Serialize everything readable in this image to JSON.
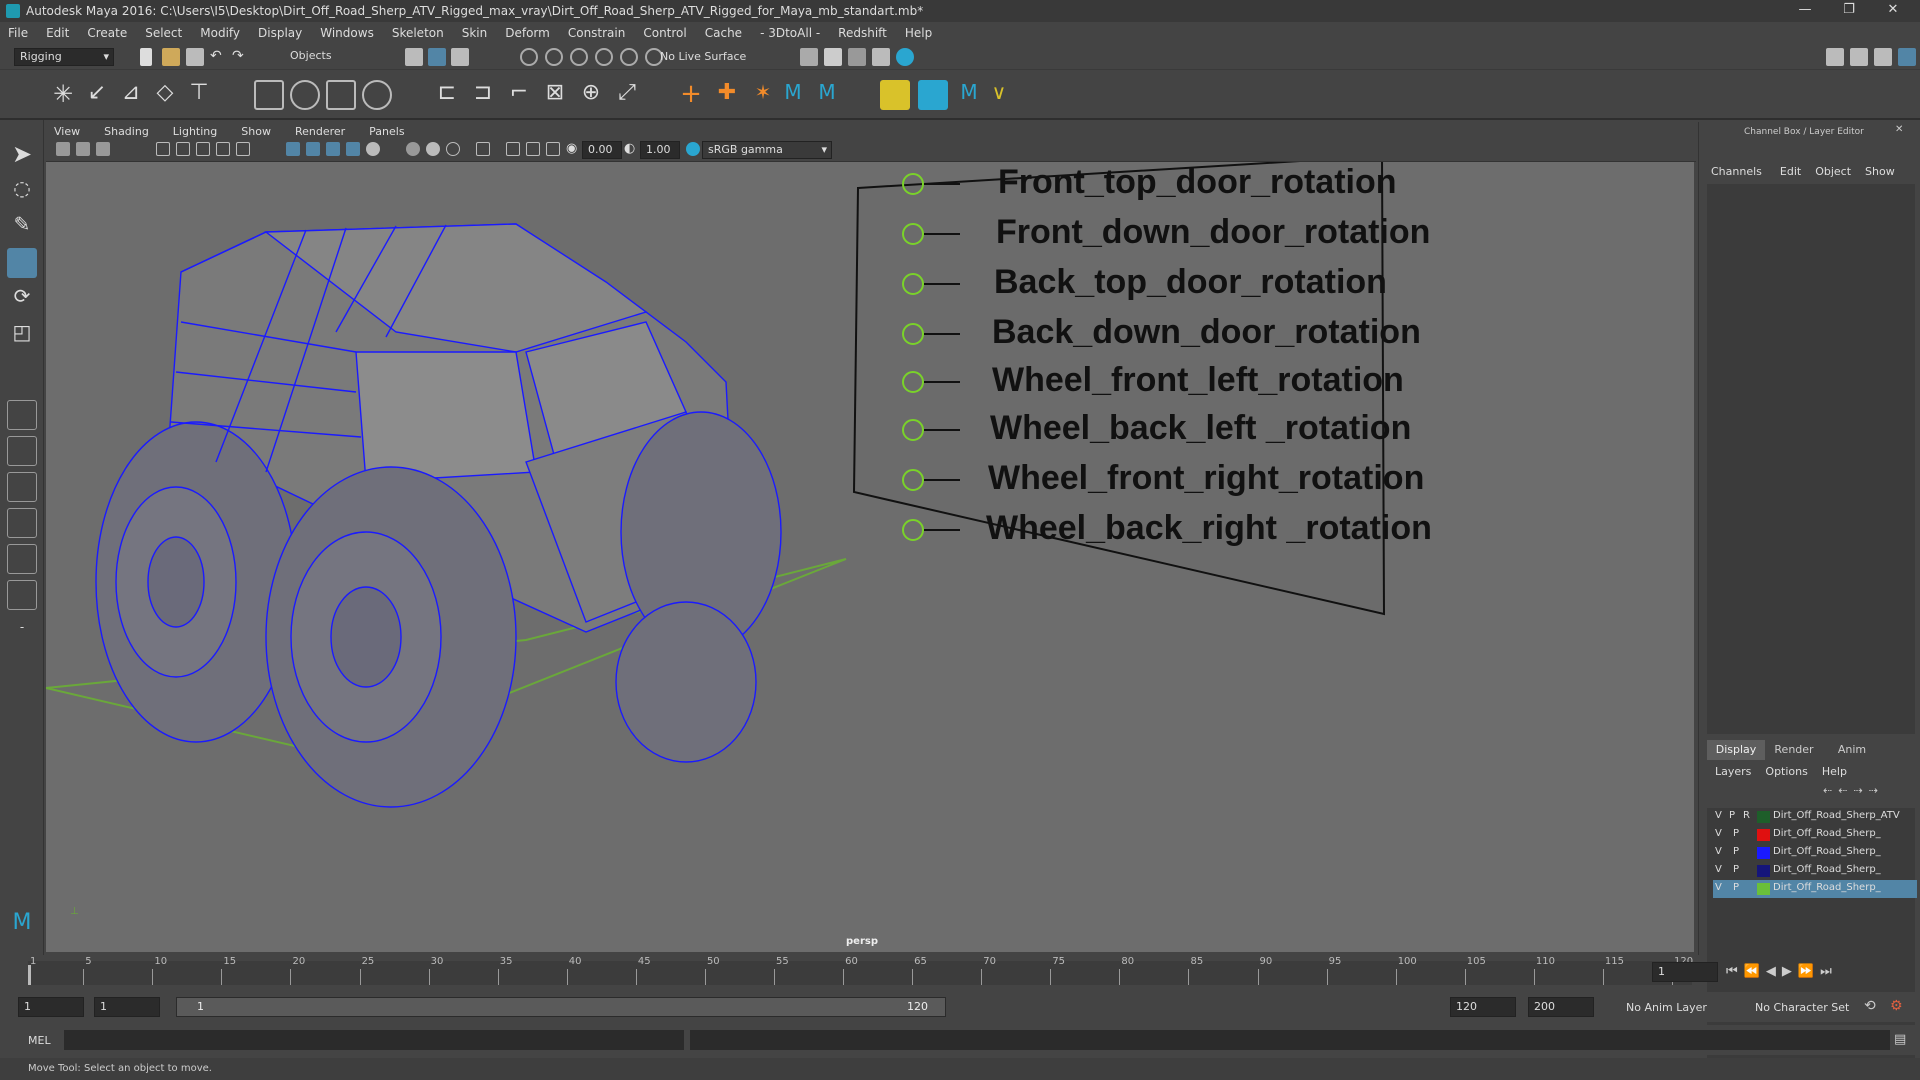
{
  "window": {
    "title": "Autodesk Maya 2016: C:\\Users\\I5\\Desktop\\Dirt_Off_Road_Sherp_ATV_Rigged_max_vray\\Dirt_Off_Road_Sherp_ATV_Rigged_for_Maya_mb_standart.mb*",
    "controls": [
      "—",
      "❐",
      "✕"
    ]
  },
  "menubar": [
    "File",
    "Edit",
    "Create",
    "Select",
    "Modify",
    "Display",
    "Windows",
    "Skeleton",
    "Skin",
    "Deform",
    "Constrain",
    "Control",
    "Cache",
    "- 3DtoAll -",
    "Redshift",
    "Help"
  ],
  "statusline": {
    "mode": "Rigging",
    "selection_mask": "Objects",
    "live_surface": "No Live Surface"
  },
  "panel": {
    "menu": [
      "View",
      "Shading",
      "Lighting",
      "Show",
      "Renderer",
      "Panels"
    ],
    "near_value": "0.00",
    "far_value": "1.00",
    "color_space": "sRGB gamma",
    "camera_label": "persp"
  },
  "rig_labels": [
    "Front_top_door_rotation",
    "Front_down_door_rotation",
    "Back_top_door_rotation",
    "Back_down_door_rotation",
    "Wheel_front_left_rotation",
    "Wheel_back_left _rotation",
    "Wheel_front_right_rotation",
    "Wheel_back_right _rotation"
  ],
  "channel_box": {
    "header": "Channel Box / Layer Editor",
    "menu": [
      "Channels",
      "Edit",
      "Object",
      "Show"
    ],
    "layer_tabs": [
      "Display",
      "Render",
      "Anim"
    ],
    "layer_menu": [
      "Layers",
      "Options",
      "Help"
    ],
    "layers": [
      {
        "v": "V",
        "p": "P",
        "r": "R",
        "color": "#1e5e2a",
        "name": "Dirt_Off_Road_Sherp_ATV"
      },
      {
        "v": "V",
        "p": "P",
        "r": "",
        "color": "#e01010",
        "name": "Dirt_Off_Road_Sherp_"
      },
      {
        "v": "V",
        "p": "P",
        "r": "",
        "color": "#1a1aff",
        "name": "Dirt_Off_Road_Sherp_"
      },
      {
        "v": "V",
        "p": "P",
        "r": "",
        "color": "#15157a",
        "name": "Dirt_Off_Road_Sherp_"
      },
      {
        "v": "V",
        "p": "P",
        "r": "",
        "color": "#6abf3a",
        "name": "Dirt_Off_Road_Sherp_"
      }
    ]
  },
  "timeline": {
    "ticks": [
      "1",
      "5",
      "10",
      "15",
      "20",
      "25",
      "30",
      "35",
      "40",
      "45",
      "50",
      "55",
      "60",
      "65",
      "70",
      "75",
      "80",
      "85",
      "90",
      "95",
      "100",
      "105",
      "110",
      "115",
      "120"
    ],
    "current_frame": "1"
  },
  "range": {
    "start": "1",
    "anim_start": "1",
    "slider_start": "1",
    "slider_end": "120",
    "anim_end": "120",
    "end": "200",
    "anim_layer": "No Anim Layer",
    "character_set": "No Character Set"
  },
  "mel": {
    "label": "MEL"
  },
  "help_line": "Move Tool: Select an object to move.",
  "colors": {
    "accent": "#5285a6",
    "wire": "#1a1aff",
    "grid": "#6aa83a"
  }
}
